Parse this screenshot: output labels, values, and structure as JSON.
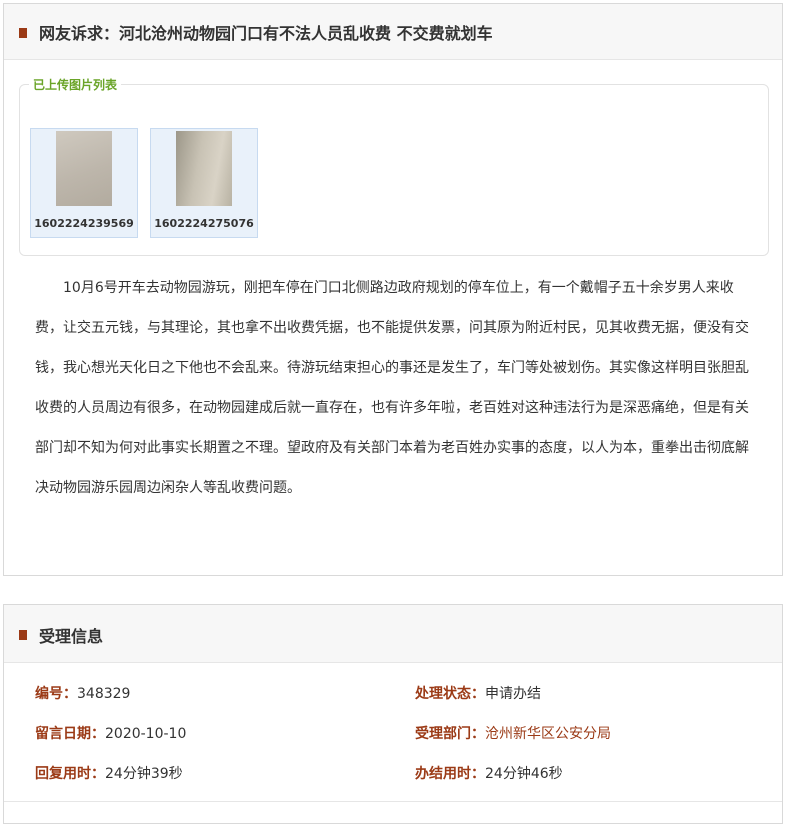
{
  "complaint": {
    "header_title": "网友诉求：河北沧州动物园门口有不法人员乱收费 不交费就划车",
    "pictures_legend": "已上传图片列表",
    "pictures": [
      {
        "caption": "1602224239569"
      },
      {
        "caption": "1602224275076"
      }
    ],
    "content": "10月6号开车去动物园游玩，刚把车停在门口北侧路边政府规划的停车位上，有一个戴帽子五十余岁男人来收费，让交五元钱，与其理论，其也拿不出收费凭据，也不能提供发票，问其原为附近村民，见其收费无据，便没有交钱，我心想光天化日之下他也不会乱来。待游玩结束担心的事还是发生了，车门等处被划伤。其实像这样明目张胆乱收费的人员周边有很多，在动物园建成后就一直存在，也有许多年啦，老百姓对这种违法行为是深恶痛绝，但是有关部门却不知为何对此事实长期置之不理。望政府及有关部门本着为老百姓办实事的态度，以人为本，重拳出击彻底解决动物园游乐园周边闲杂人等乱收费问题。"
  },
  "acceptance": {
    "header_title": "受理信息",
    "id_label": "编号：",
    "id_value": "348329",
    "status_label": "处理状态：",
    "status_value": "申请办结",
    "date_label": "留言日期：",
    "date_value": "2020-10-10",
    "dept_label": "受理部门：",
    "dept_value": "沧州新华区公安分局",
    "reply_time_label": "回复用时：",
    "reply_time_value": "24分钟39秒",
    "finish_time_label": "办结用时：",
    "finish_time_value": "24分钟46秒"
  },
  "colors": {
    "accent": "#9b3a16",
    "legend_green": "#6aa428"
  }
}
